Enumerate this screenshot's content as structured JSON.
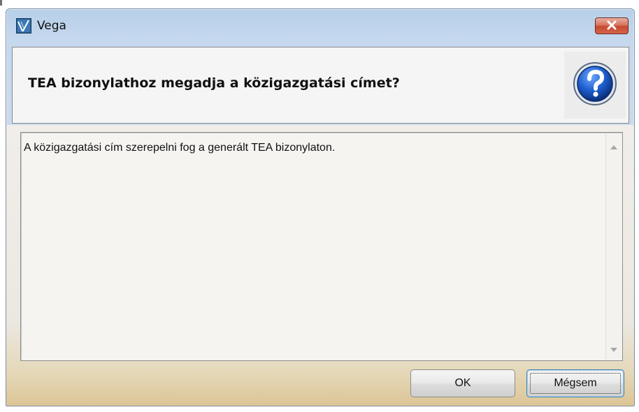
{
  "window": {
    "title": "Vega",
    "icons": {
      "app": "vega-app-icon",
      "close": "close-icon",
      "help": "question-mark-icon",
      "scroll_up": "scroll-up-arrow-icon",
      "scroll_down": "scroll-down-arrow-icon"
    },
    "colors": {
      "close_button": "#c5492f",
      "help_icon": "#1d5ab8"
    }
  },
  "dialog": {
    "question": "TEA bizonylathoz megadja a közigazgatási címet?",
    "message": "A közigazgatási cím szerepelni fog a generált TEA bizonylaton."
  },
  "buttons": {
    "ok_label": "OK",
    "cancel_label": "Mégsem"
  }
}
